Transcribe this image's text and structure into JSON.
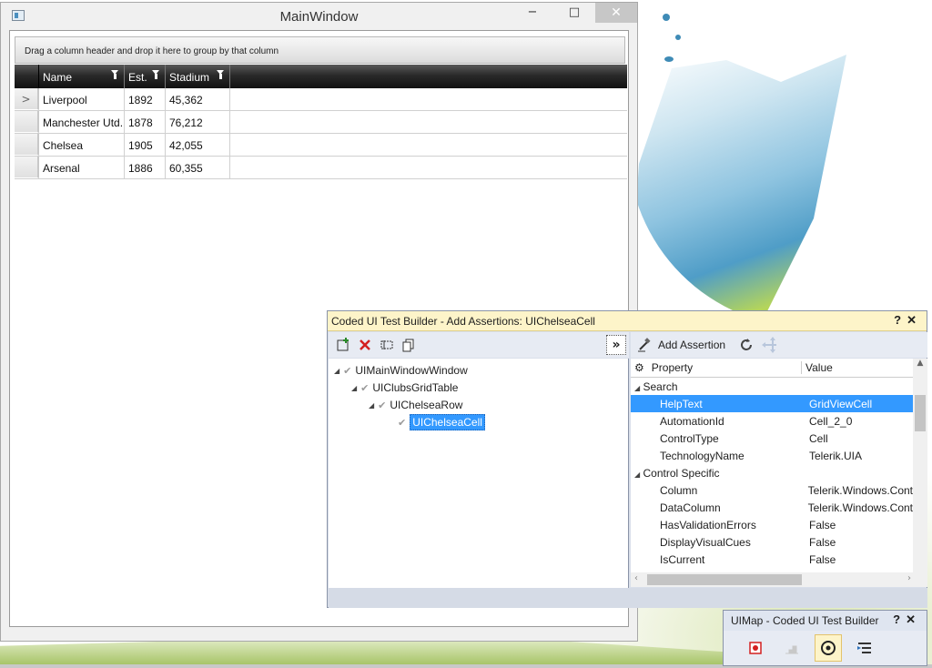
{
  "main_window": {
    "title": "MainWindow",
    "minimize": "−",
    "maximize": "□",
    "close": "✕",
    "group_panel_hint": "Drag a column header and drop it here to group by that column",
    "columns": [
      "Name",
      "Est.",
      "Stadium"
    ],
    "rows": [
      {
        "indicator": ">",
        "name": "Liverpool",
        "est": "1892",
        "stadium": "45,362"
      },
      {
        "indicator": "",
        "name": "Manchester Utd.",
        "est": "1878",
        "stadium": "76,212"
      },
      {
        "indicator": "",
        "name": "Chelsea",
        "est": "1905",
        "stadium": "42,055"
      },
      {
        "indicator": "",
        "name": "Arsenal",
        "est": "1886",
        "stadium": "60,355"
      }
    ]
  },
  "test_builder": {
    "title": "Coded UI Test Builder - Add Assertions: UIChelseaCell",
    "help": "?",
    "close": "✕",
    "expand_button": "»",
    "add_assertion_label": "Add Assertion",
    "tree": [
      {
        "label": "UIMainWindowWindow",
        "selected": false
      },
      {
        "label": "UIClubsGridTable",
        "selected": false
      },
      {
        "label": "UIChelseaRow",
        "selected": false
      },
      {
        "label": "UIChelseaCell",
        "selected": true
      }
    ],
    "property_header": "Property",
    "value_header": "Value",
    "categories": [
      {
        "name": "Search",
        "props": [
          {
            "name": "HelpText",
            "value": "GridViewCell",
            "selected": true
          },
          {
            "name": "AutomationId",
            "value": "Cell_2_0",
            "selected": false
          },
          {
            "name": "ControlType",
            "value": "Cell",
            "selected": false
          },
          {
            "name": "TechnologyName",
            "value": "Telerik.UIA",
            "selected": false
          }
        ]
      },
      {
        "name": "Control Specific",
        "props": [
          {
            "name": "Column",
            "value": "Telerik.Windows.Cont",
            "selected": false
          },
          {
            "name": "DataColumn",
            "value": "Telerik.Windows.Cont",
            "selected": false
          },
          {
            "name": "HasValidationErrors",
            "value": "False",
            "selected": false
          },
          {
            "name": "DisplayVisualCues",
            "value": "False",
            "selected": false
          },
          {
            "name": "IsCurrent",
            "value": "False",
            "selected": false
          }
        ]
      }
    ]
  },
  "uimap": {
    "title": "UIMap - Coded UI Test Builder",
    "help": "?",
    "close": "✕"
  }
}
